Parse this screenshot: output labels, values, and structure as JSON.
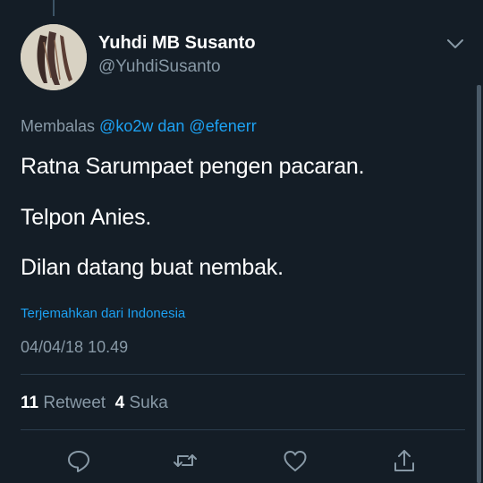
{
  "tweet": {
    "author_name": "Yuhdi MB Susanto",
    "author_handle": "@YuhdiSusanto",
    "reply_prefix": "Membalas",
    "reply_mention_1": "@ko2w",
    "reply_conjunction": "dan",
    "reply_mention_2": "@efenerr",
    "lines": [
      "Ratna Sarumpaet pengen pacaran.",
      "Telpon Anies.",
      "Dilan datang buat nembak."
    ],
    "translate_label": "Terjemahkan dari Indonesia",
    "timestamp": "04/04/18 10.49"
  },
  "stats": {
    "retweet_count": "11",
    "retweet_label": "Retweet",
    "like_count": "4",
    "like_label": "Suka"
  },
  "actions": {
    "reply_icon": "reply-icon",
    "retweet_icon": "retweet-icon",
    "like_icon": "heart-icon",
    "share_icon": "share-icon"
  },
  "colors": {
    "background": "#141d26",
    "secondary_text": "#8899a6",
    "link": "#1da1f2",
    "divider": "#2c3e4e"
  }
}
